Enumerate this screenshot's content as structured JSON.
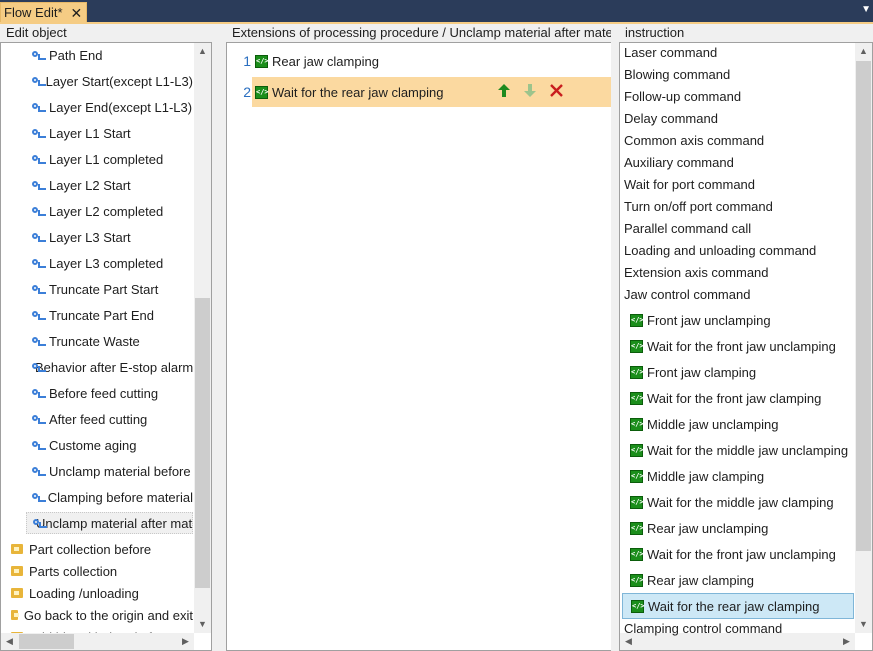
{
  "tab": {
    "title": "Flow Edit*",
    "close_icon": "close-icon"
  },
  "left": {
    "title": "Edit object",
    "items": [
      {
        "label": "Path End",
        "type": "flow"
      },
      {
        "label": "Layer Start(except L1-L3)",
        "type": "flow"
      },
      {
        "label": "Layer End(except L1-L3)",
        "type": "flow"
      },
      {
        "label": "Layer L1 Start",
        "type": "flow"
      },
      {
        "label": "Layer L1 completed",
        "type": "flow"
      },
      {
        "label": "Layer L2 Start",
        "type": "flow"
      },
      {
        "label": "Layer L2 completed",
        "type": "flow"
      },
      {
        "label": "Layer L3 Start",
        "type": "flow"
      },
      {
        "label": "Layer L3 completed",
        "type": "flow"
      },
      {
        "label": "Truncate Part Start",
        "type": "flow"
      },
      {
        "label": "Truncate Part End",
        "type": "flow"
      },
      {
        "label": "Truncate Waste",
        "type": "flow"
      },
      {
        "label": "Behavior after E-stop alarm",
        "type": "flow"
      },
      {
        "label": "Before feed cutting",
        "type": "flow"
      },
      {
        "label": "After feed cutting",
        "type": "flow"
      },
      {
        "label": "Custome aging",
        "type": "flow"
      },
      {
        "label": "Unclamp material before",
        "type": "flow"
      },
      {
        "label": "Clamping before material",
        "type": "flow"
      },
      {
        "label": "Unclamp material after material",
        "type": "flow",
        "selected": true
      },
      {
        "label": "Part collection before",
        "type": "folder"
      },
      {
        "label": "Parts collection",
        "type": "folder"
      },
      {
        "label": "Loading /unloading",
        "type": "folder"
      },
      {
        "label": "Go back to the origin and exit",
        "type": "folder"
      },
      {
        "label": "Add ld and lad and after",
        "type": "folder"
      }
    ]
  },
  "middle": {
    "title": "Extensions of processing procedure / Unclamp material after material",
    "steps": [
      {
        "no": "1",
        "label": "Rear jaw clamping"
      },
      {
        "no": "2",
        "label": "Wait for the rear jaw clamping",
        "selected": true
      }
    ],
    "actions": {
      "up": "arrow-up-icon",
      "down": "arrow-down-icon",
      "delete": "delete-icon",
      "colors": {
        "up": "#1f8a1f",
        "down": "#9cc48c",
        "delete": "#c81e1e"
      }
    }
  },
  "right": {
    "title": "instruction",
    "commands": [
      "Laser command",
      "Blowing command",
      "Follow-up command",
      "Delay command",
      "Common axis command",
      "Auxiliary command",
      "Wait for port command",
      "Turn on/off port command",
      "Parallel command call",
      "Loading and unloading command",
      "Extension axis command",
      "Jaw control command"
    ],
    "jaw_items": [
      "Front jaw unclamping",
      "Wait for the front jaw unclamping",
      "Front jaw clamping",
      "Wait for the front jaw clamping",
      "Middle jaw unclamping",
      "Wait for the middle jaw unclamping",
      "Middle jaw clamping",
      "Wait for the middle jaw clamping",
      "Rear jaw unclamping",
      "Wait for the front jaw unclamping",
      "Rear jaw clamping",
      "Wait for the rear jaw clamping"
    ],
    "selected_jaw_index": 11,
    "after": "Clamping control command"
  },
  "colors": {
    "tab": "#f5cc84",
    "selection_row": "#fbd9a0",
    "list_selection": "#cde8f6",
    "titlebar": "#2b3c5a"
  }
}
